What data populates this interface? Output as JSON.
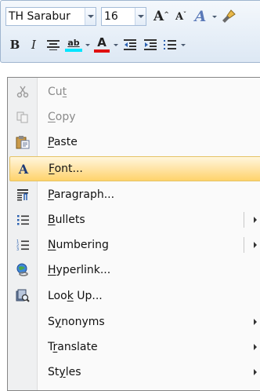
{
  "toolbar": {
    "font_name": "TH Sarabur",
    "font_size": "16",
    "grow_font_glyph": "A",
    "shrink_font_glyph": "A",
    "styles_glyph": "A",
    "bold_glyph": "B",
    "italic_glyph": "I",
    "font_color_glyph": "A",
    "highlight_glyph": "ab"
  },
  "menu": {
    "cut": {
      "pre": "Cu",
      "key": "t",
      "post": ""
    },
    "copy": {
      "pre": "",
      "key": "C",
      "post": "opy"
    },
    "paste": {
      "pre": "",
      "key": "P",
      "post": "aste"
    },
    "font": {
      "pre": "",
      "key": "F",
      "post": "ont..."
    },
    "paragraph": {
      "pre": "",
      "key": "P",
      "post": "aragraph..."
    },
    "bullets": {
      "pre": "",
      "key": "B",
      "post": "ullets"
    },
    "numbering": {
      "pre": "",
      "key": "N",
      "post": "umbering"
    },
    "hyperlink": {
      "pre": "",
      "key": "H",
      "post": "yperlink..."
    },
    "lookup": {
      "pre": "Loo",
      "key": "k",
      "post": " Up..."
    },
    "synonyms": {
      "pre": "S",
      "key": "y",
      "post": "nonyms"
    },
    "translate": {
      "pre": "T",
      "key": "r",
      "post": "anslate"
    },
    "styles": {
      "pre": "St",
      "key": "y",
      "post": "les"
    }
  }
}
